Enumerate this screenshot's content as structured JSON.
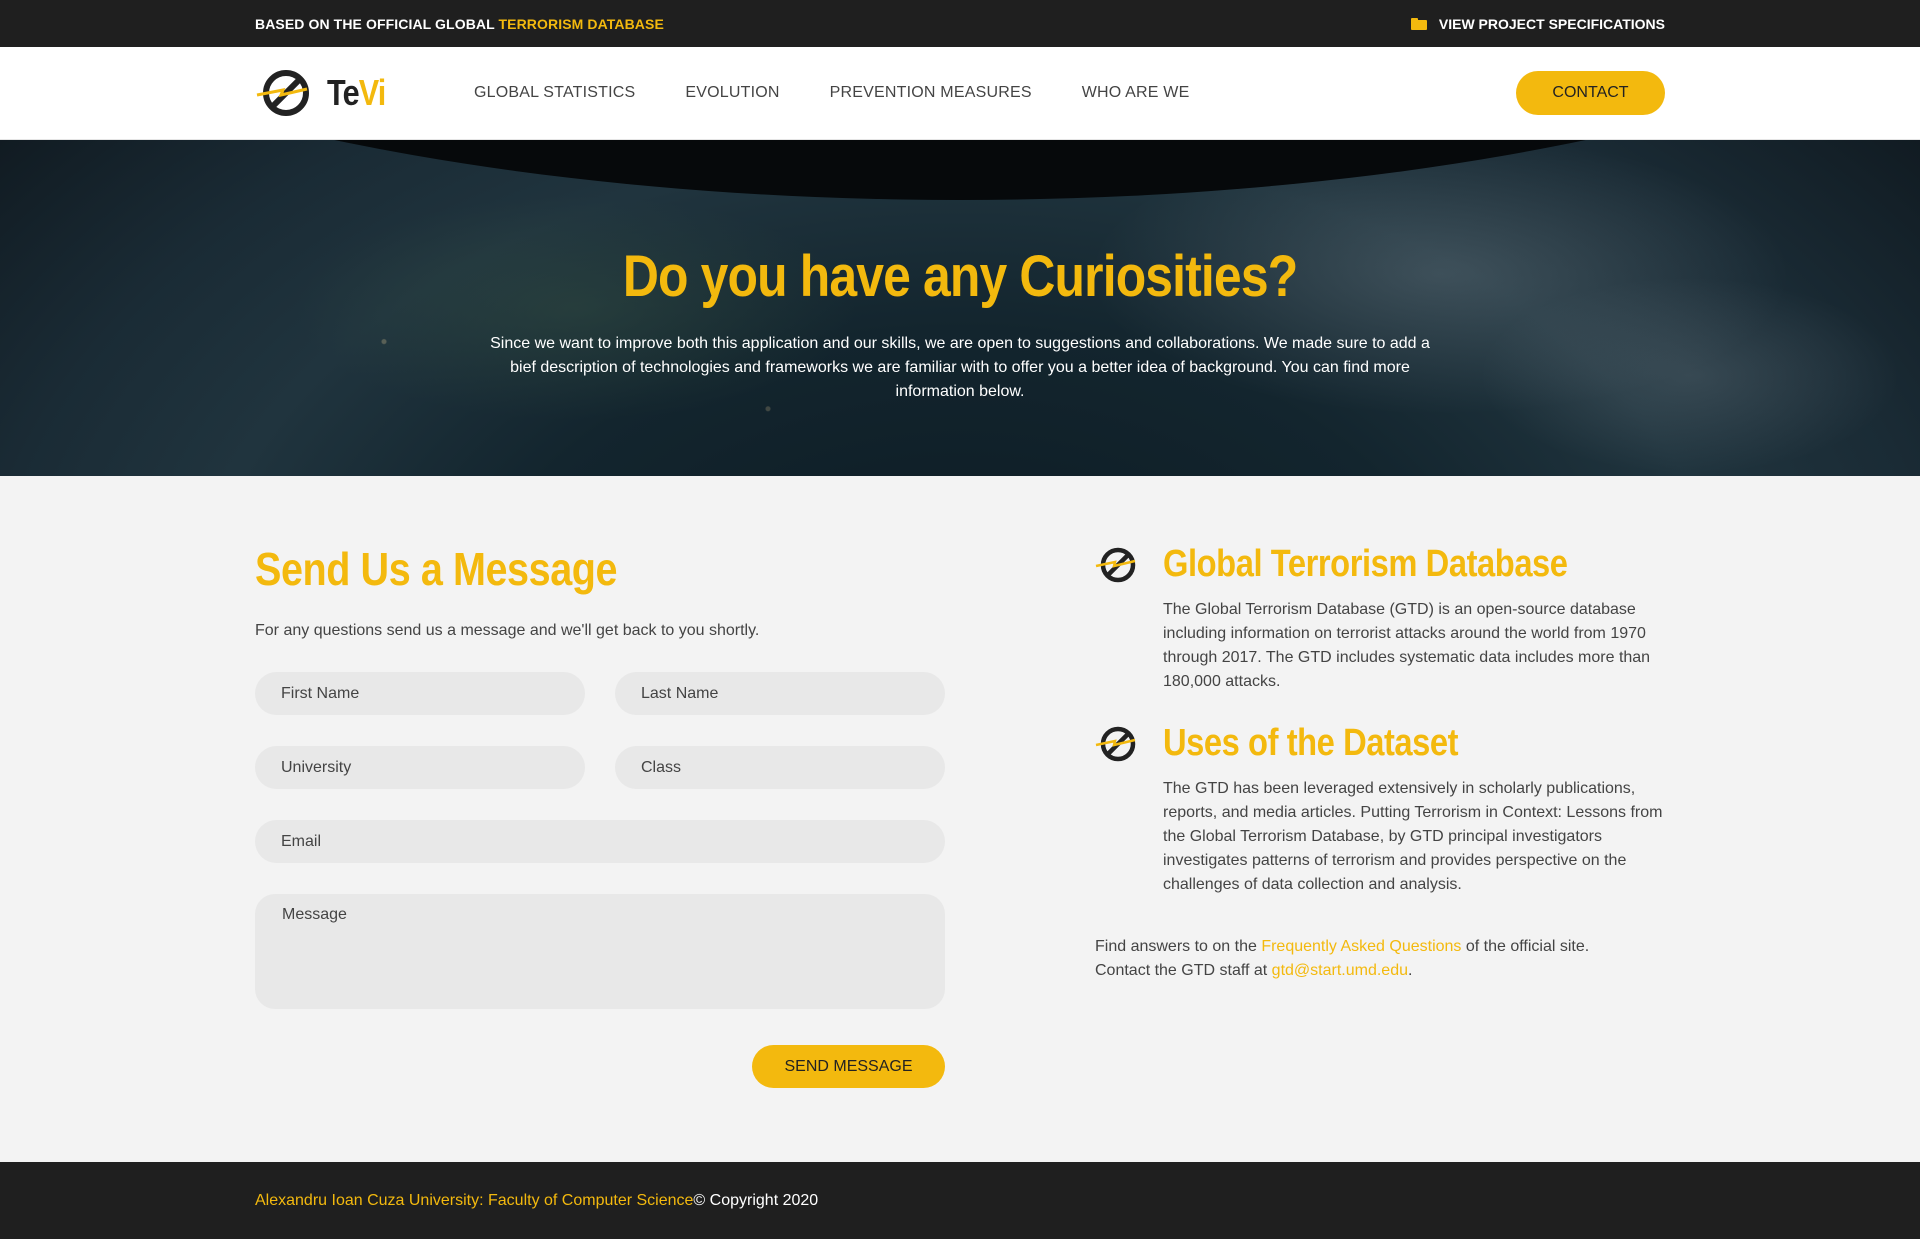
{
  "topbar": {
    "based_prefix": "BASED ON THE OFFICIAL GLOBAL ",
    "based_accent": "TERRORISM DATABASE",
    "specs_label": "VIEW PROJECT SPECIFICATIONS"
  },
  "nav": {
    "logo_te": "Te",
    "logo_vi": "Vi",
    "menu": [
      "GLOBAL STATISTICS",
      "EVOLUTION",
      "PREVENTION MEASURES",
      "WHO ARE WE"
    ],
    "contact_label": "CONTACT"
  },
  "hero": {
    "title": "Do you have any Curiosities?",
    "text": "Since we want to improve both this application and our skills, we are open to suggestions and collaborations. We made sure to add a bief description of technologies and frameworks we are familiar with to offer you a better idea of background. You can find more information below."
  },
  "form": {
    "title": "Send Us a Message",
    "lead": "For any questions send us a message and we'll get back to you shortly.",
    "first_name_placeholder": "First Name",
    "last_name_placeholder": "Last Name",
    "university_placeholder": "University",
    "class_placeholder": "Class",
    "email_placeholder": "Email",
    "message_placeholder": "Message",
    "send_label": "SEND MESSAGE"
  },
  "info": {
    "items": [
      {
        "title": "Global Terrorism Database",
        "text": "The Global Terrorism Database (GTD) is an open-source database including information on terrorist attacks around the world from 1970 through 2017. The GTD includes systematic data includes more than 180,000 attacks."
      },
      {
        "title": "Uses of the Dataset",
        "text": "The GTD has been leveraged extensively in scholarly publications, reports, and media articles. Putting Terrorism in Context: Lessons from the Global Terrorism Database, by GTD principal investigators investigates patterns of terrorism and provides perspective on the challenges of data collection and analysis."
      }
    ],
    "faq_prefix": "Find answers to on the ",
    "faq_link": "Frequently Asked Questions",
    "faq_suffix": " of the official site.",
    "contact_prefix": "Contact the GTD staff at ",
    "contact_email": "gtd@start.umd.edu",
    "contact_suffix": "."
  },
  "footer": {
    "university": "Alexandru Ioan Cuza University: Faculty of Computer Science",
    "copyright": " © Copyright 2020"
  },
  "colors": {
    "accent": "#f3b90e",
    "dark": "#1f1f1f"
  }
}
